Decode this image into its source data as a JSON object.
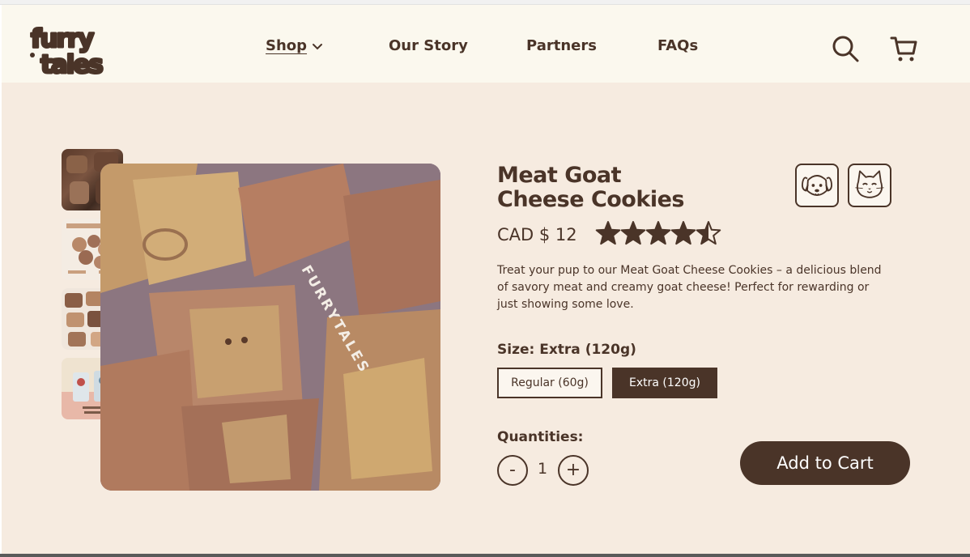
{
  "brand": {
    "logo_line1": "furry",
    "logo_line2": "tales"
  },
  "nav": {
    "shop": "Shop",
    "our_story": "Our Story",
    "partners": "Partners",
    "faqs": "FAQs"
  },
  "header_icons": [
    "search-icon",
    "cart-icon"
  ],
  "gallery": {
    "image_count": 5,
    "main_image_text": "FURRYTALES",
    "selected_thumb": 1
  },
  "product": {
    "title_line1": "Meat Goat",
    "title_line2": "Cheese Cookies",
    "price": "CAD $ 12",
    "rating": 4.5,
    "rating_max": 5,
    "pet_icons": [
      "dog-icon",
      "cat-icon"
    ],
    "description": "Treat your pup to our Meat Goat Cheese Cookies – a delicious blend of savory meat and creamy goat cheese! Perfect for rewarding or just showing some love.",
    "size_label": "Size: Extra (120g)",
    "sizes": [
      {
        "label": "Regular (60g)",
        "selected": false
      },
      {
        "label": "Extra (120g)",
        "selected": true
      }
    ],
    "quantity_label": "Quantities:",
    "quantity": "1",
    "minus_label": "-",
    "plus_label": "+",
    "add_to_cart": "Add to Cart"
  },
  "colors": {
    "brand_brown": "#4a3428",
    "page_bg": "#f6ebe0",
    "header_bg": "#fbf8ee"
  }
}
